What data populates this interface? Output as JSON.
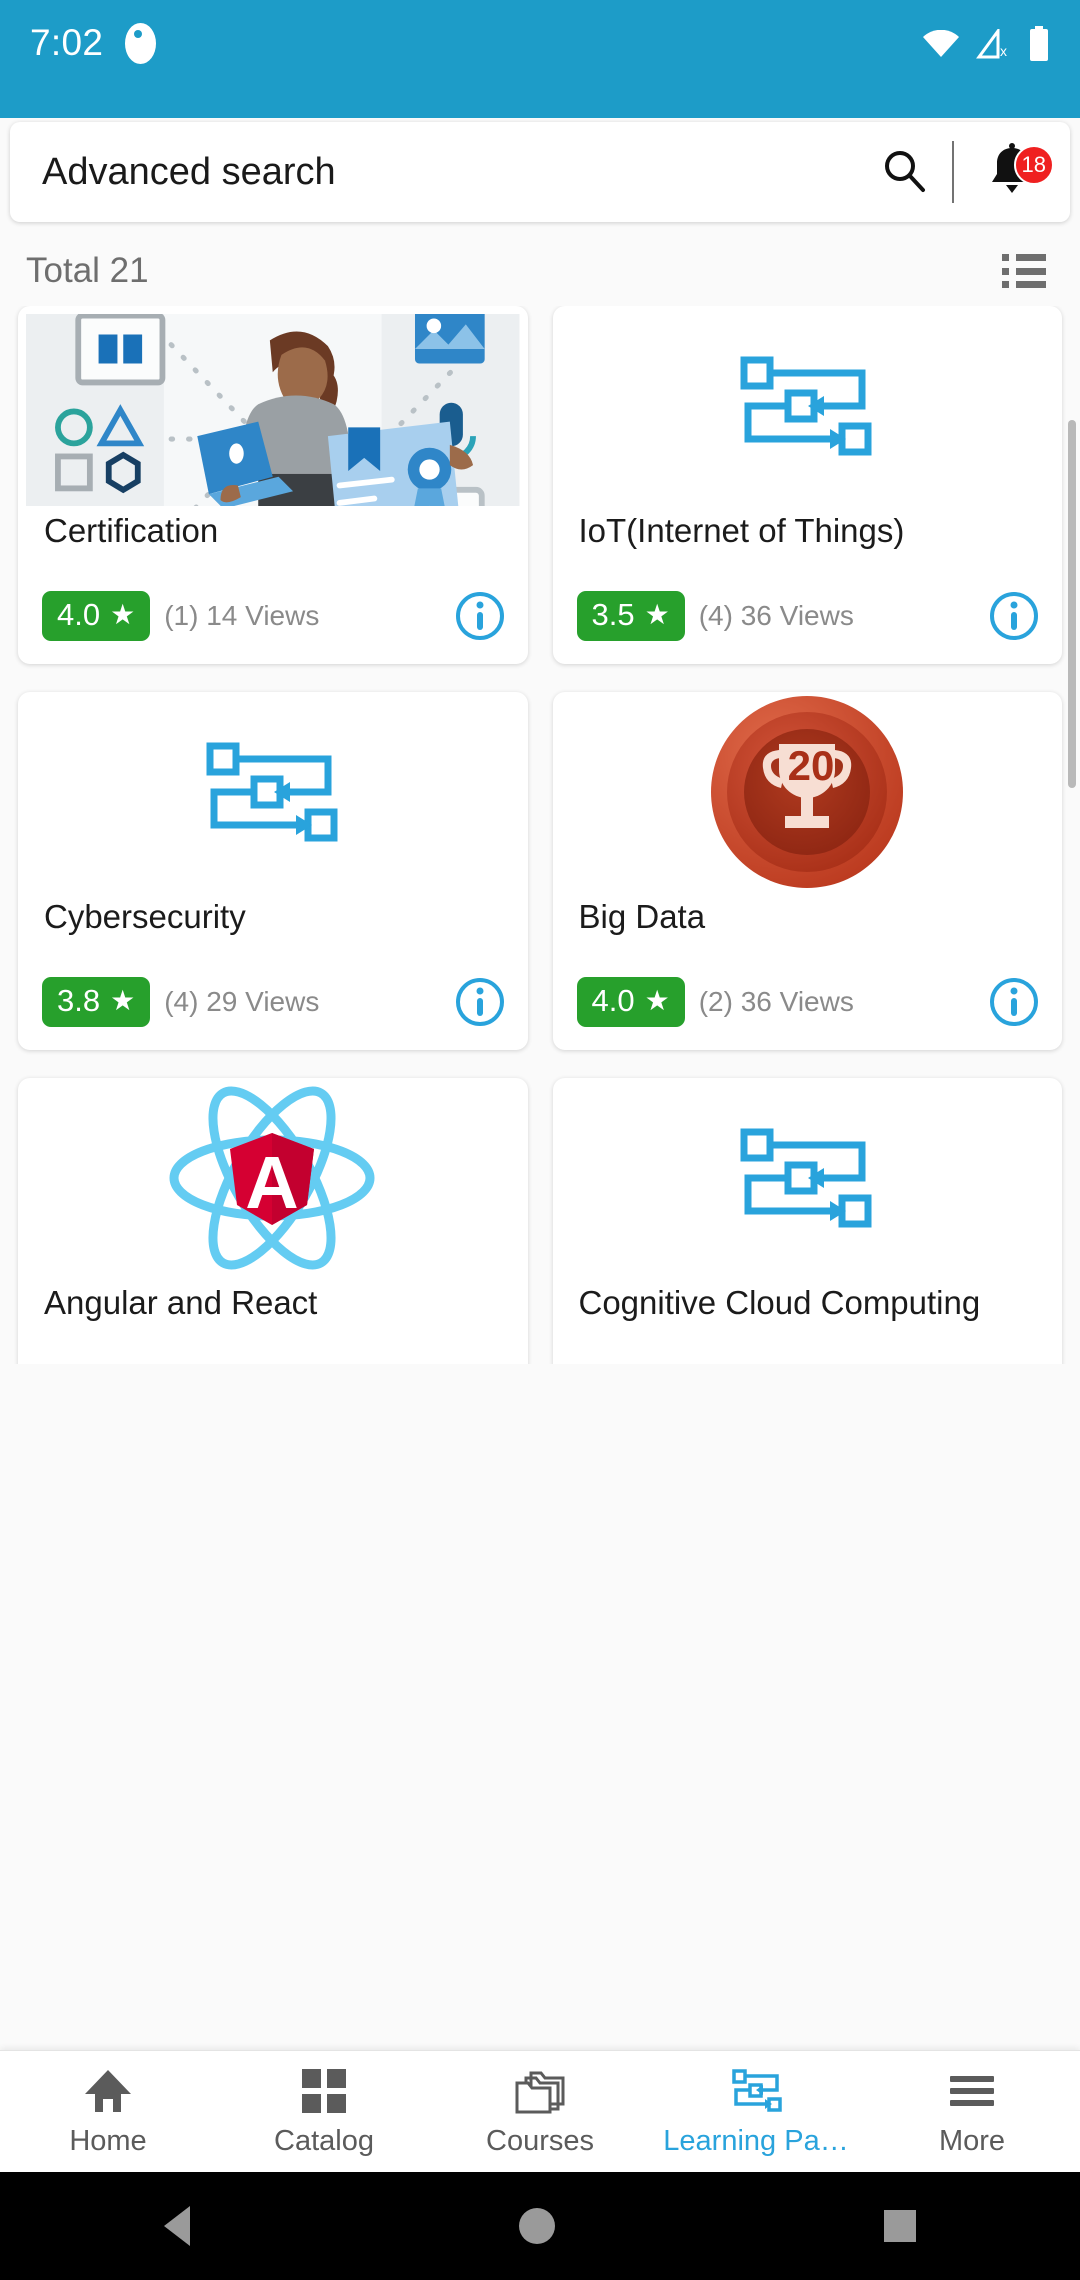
{
  "statusbar": {
    "time": "7:02",
    "app_icon": "app-notification-icon",
    "wifi_icon": "wifi-icon",
    "cellular_icon": "cellular-no-signal-icon",
    "battery_icon": "battery-full-icon",
    "background_color": "#1d9cc8"
  },
  "search": {
    "value": "Advanced search",
    "placeholder": "Advanced search",
    "search_icon": "search-icon",
    "bell_icon": "notification-bell-icon",
    "bell_badge": "18",
    "badge_color": "#ef2020"
  },
  "toolbar": {
    "total_label": "Total 21",
    "view_toggle_icon": "list-view-icon"
  },
  "cards": [
    {
      "title": "Certification",
      "rating": "4.0",
      "star": "★",
      "views": "(1) 14 Views",
      "media": "certification-illustration",
      "info_icon": "info-icon"
    },
    {
      "title": "IoT(Internet of Things)",
      "rating": "3.5",
      "star": "★",
      "views": "(4) 36 Views",
      "media": "flowchart-icon",
      "info_icon": "info-icon"
    },
    {
      "title": "Cybersecurity",
      "rating": "3.8",
      "star": "★",
      "views": "(4) 29 Views",
      "media": "flowchart-icon",
      "info_icon": "info-icon"
    },
    {
      "title": "Big Data",
      "rating": "4.0",
      "star": "★",
      "views": "(2) 36 Views",
      "media": "trophy-badge-20",
      "badge_number": "20",
      "info_icon": "info-icon"
    },
    {
      "title": "Angular and React",
      "rating": "",
      "star": "★",
      "views": "",
      "media": "angular-react-atom-logo",
      "info_icon": "info-icon"
    },
    {
      "title": "Cognitive Cloud Computing",
      "rating": "",
      "star": "★",
      "views": "",
      "media": "flowchart-icon",
      "info_icon": "info-icon"
    }
  ],
  "bottom_nav": {
    "active_color": "#29a3dc",
    "items": [
      {
        "label": "Home",
        "icon": "home-icon",
        "active": false
      },
      {
        "label": "Catalog",
        "icon": "grid-squares-icon",
        "active": false
      },
      {
        "label": "Courses",
        "icon": "folders-icon",
        "active": false
      },
      {
        "label": "Learning Pa…",
        "icon": "flowchart-icon",
        "active": true
      },
      {
        "label": "More",
        "icon": "hamburger-menu-icon",
        "active": false
      }
    ]
  },
  "system_nav": {
    "back_icon": "back-triangle-icon",
    "home_icon": "home-circle-icon",
    "recents_icon": "recents-square-icon"
  },
  "colors": {
    "accent": "#1d9cc8",
    "rating_green": "#27a02c",
    "info_blue": "#29a3dc",
    "badge_red": "#ef2020"
  }
}
